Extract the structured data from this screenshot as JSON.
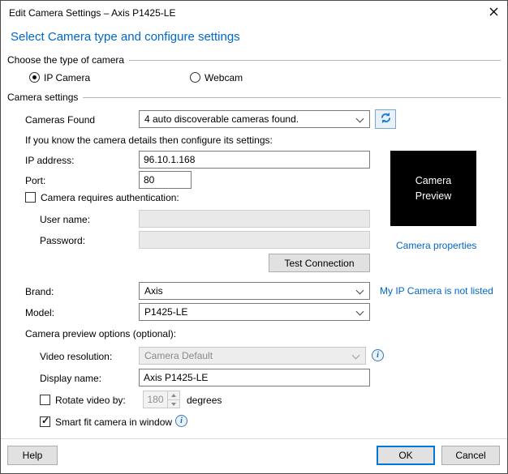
{
  "icons": {
    "info": "i",
    "check": "✓"
  },
  "window": {
    "title": "Edit Camera Settings – Axis P1425-LE"
  },
  "heading": "Select Camera type and configure settings",
  "camera_type": {
    "group_label": "Choose the type of camera",
    "options": [
      {
        "label": "IP Camera",
        "selected": true
      },
      {
        "label": "Webcam",
        "selected": false
      }
    ]
  },
  "settings": {
    "group_label": "Camera settings",
    "cameras_found": {
      "label": "Cameras Found",
      "value": "4 auto discoverable cameras found."
    },
    "hint": "If you know the camera details then configure its settings:",
    "ip": {
      "label": "IP address:",
      "value": "96.10.1.168"
    },
    "port": {
      "label": "Port:",
      "value": "80"
    },
    "auth": {
      "label": "Camera requires authentication:",
      "checked": false
    },
    "username": {
      "label": "User name:",
      "value": ""
    },
    "password": {
      "label": "Password:",
      "value": ""
    },
    "test_connection": "Test Connection",
    "brand": {
      "label": "Brand:",
      "value": "Axis"
    },
    "model": {
      "label": "Model:",
      "value": "P1425-LE"
    },
    "preview_options_label": "Camera preview options (optional):",
    "video_resolution": {
      "label": "Video resolution:",
      "value": "Camera Default"
    },
    "display_name": {
      "label": "Display name:",
      "value": "Axis P1425-LE"
    },
    "rotate": {
      "label": "Rotate video by:",
      "value": "180",
      "suffix": "degrees",
      "checked": false
    },
    "smart_fit": {
      "label": "Smart fit camera in window",
      "checked": true
    }
  },
  "preview": {
    "placeholder": "Camera Preview",
    "properties_link": "Camera properties",
    "not_listed_link": "My IP Camera is not listed"
  },
  "footer": {
    "help": "Help",
    "ok": "OK",
    "cancel": "Cancel"
  },
  "colors": {
    "heading": "#0068c8",
    "link": "#0066cc",
    "accent": "#0078d7"
  }
}
